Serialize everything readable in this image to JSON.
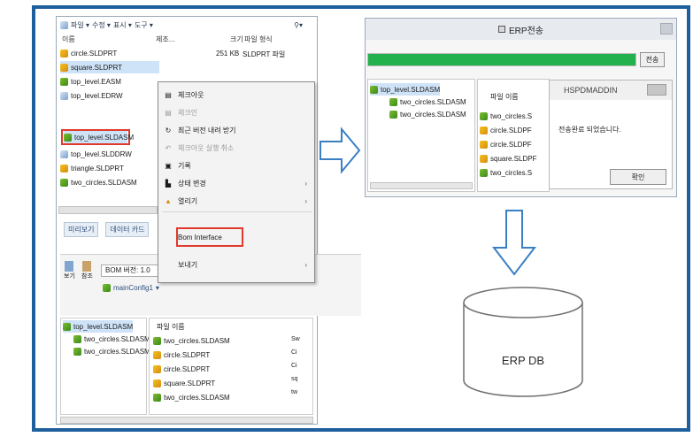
{
  "explorer": {
    "toolbar": [
      "파일 ▾",
      "수정 ▾",
      "표시 ▾",
      "도구 ▾"
    ],
    "columns": {
      "name": "이름",
      "date": "제조...",
      "size": "크기",
      "type": "파일 형식"
    },
    "files": [
      {
        "name": "circle.SLDPRT",
        "size": "251 KB",
        "type": "SLDPRT 파일",
        "icon": "part"
      },
      {
        "name": "square.SLDPRT",
        "size": "",
        "type": "",
        "icon": "part"
      },
      {
        "name": "top_level.EASM",
        "size": "",
        "type": "",
        "icon": "asm"
      },
      {
        "name": "top_level.EDRW",
        "size": "",
        "type": "",
        "icon": "draw"
      },
      {
        "name": "top_level.SLDASM",
        "size": "",
        "type": "",
        "icon": "asm"
      },
      {
        "name": "top_level.SLDDRW",
        "size": "",
        "type": "",
        "icon": "draw"
      },
      {
        "name": "triangle.SLDPRT",
        "size": "",
        "type": "",
        "icon": "part"
      },
      {
        "name": "two_circles.SLDASM",
        "size": "",
        "type": "",
        "icon": "asm"
      }
    ],
    "lower_tabs": [
      "미리보기",
      "데이터 카드"
    ],
    "lower_buttons": [
      "보기",
      "참조"
    ],
    "bom_label": "BOM 버전: 1.0",
    "config_label": "mainConfig1",
    "tree": [
      "top_level.SLDASM",
      "two_circles.SLDASM",
      "two_circles.SLDASM"
    ],
    "file_list_header": "파일 이름",
    "file_list": [
      "two_circles.SLDASM",
      "circle.SLDPRT",
      "circle.SLDPRT",
      "square.SLDPRT",
      "two_circles.SLDASM"
    ],
    "file_list_extra": [
      "Sw",
      "Ci",
      "Ci",
      "sq",
      "tw"
    ]
  },
  "context_menu": [
    {
      "label": "체크아웃",
      "disabled": false,
      "submenu": false
    },
    {
      "label": "체크인",
      "disabled": true,
      "submenu": false
    },
    {
      "label": "최근 버전 내려 받기",
      "disabled": false,
      "submenu": false
    },
    {
      "label": "체크아웃 실행 취소",
      "disabled": true,
      "submenu": false
    },
    {
      "label": "기록",
      "disabled": false,
      "submenu": false
    },
    {
      "label": "상태 변경",
      "disabled": false,
      "submenu": true
    },
    {
      "label": "열리기",
      "disabled": false,
      "submenu": true
    },
    {
      "label": "Bom Interface",
      "disabled": false,
      "submenu": false,
      "highlighted": true
    },
    {
      "label": "보내기",
      "disabled": false,
      "submenu": true
    }
  ],
  "erp_window": {
    "title": "ERP전송",
    "progress": 1.0,
    "send_button": "전송",
    "tree": [
      "top_level.SLDASM",
      "two_circles.SLDASM",
      "two_circles.SLDASM"
    ],
    "file_header": "파일 이름",
    "files": [
      "two_circles.S",
      "circle.SLDPF",
      "circle.SLDPF",
      "square.SLDPF",
      "two_circles.S"
    ]
  },
  "dialog": {
    "title": "HSPDMADDIN",
    "message": "전송완료 되었습니다.",
    "ok_button": "확인"
  },
  "database": {
    "label": "ERP DB"
  },
  "colors": {
    "frame": "#1f5f9e",
    "progress": "#22b14c",
    "highlight": "#e03a2d",
    "arrow": "#3a7fc4"
  }
}
